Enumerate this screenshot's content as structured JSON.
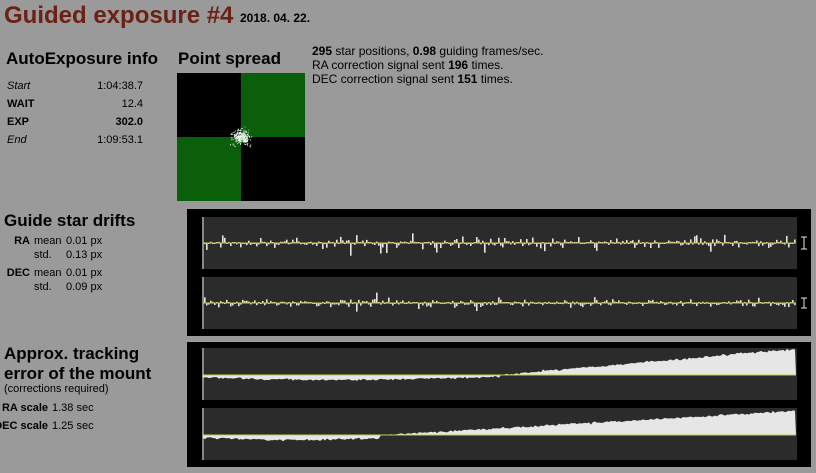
{
  "header": {
    "title": "Guided exposure #4",
    "date": "2018. 04. 22."
  },
  "autoexposure": {
    "heading": "AutoExposure info",
    "rows": [
      {
        "label": "Start",
        "value": "1:04:38.7",
        "style": "italic"
      },
      {
        "label": "WAIT",
        "value": "12.4",
        "style": "bold"
      },
      {
        "label": "EXP",
        "value": "302.0",
        "style": "bold"
      },
      {
        "label": "End",
        "value": "1:09:53.1",
        "style": "italic"
      }
    ]
  },
  "point_spread": {
    "heading": "Point spread",
    "quadrant_color": "#0b5f0b"
  },
  "summary": {
    "star_count": "295",
    "star_text": " star positions, ",
    "frame_rate": "0.98",
    "frame_text": " guiding frames/sec.",
    "ra_pre": "RA correction signal sent ",
    "ra_count": "196",
    "ra_post": " times.",
    "dec_pre": "DEC correction signal sent ",
    "dec_count": "151",
    "dec_post": " times."
  },
  "drifts": {
    "heading": "Guide star drifts",
    "ra": {
      "axis": "RA",
      "mean_label": "mean",
      "mean_value": "0.01 px",
      "std_label": "std.",
      "std_value": "0.13 px"
    },
    "dec": {
      "axis": "DEC",
      "mean_label": "mean",
      "mean_value": "0.01 px",
      "std_label": "std.",
      "std_value": "0.09 px"
    }
  },
  "tracking": {
    "heading_line1": "Approx. tracking",
    "heading_line2": "error of the mount",
    "subheading": "(corrections required)",
    "ra_scale_label": "RA scale",
    "ra_scale_value": "1.38 sec",
    "dec_scale_label": "DEC scale",
    "dec_scale_value": "1.25 sec"
  },
  "colors": {
    "title": "#6b2113",
    "panel_bg": "#2b2b2b",
    "bar": "#e6e6dc",
    "baseline": "#c8c84a",
    "green": "#0b5f0b"
  }
}
